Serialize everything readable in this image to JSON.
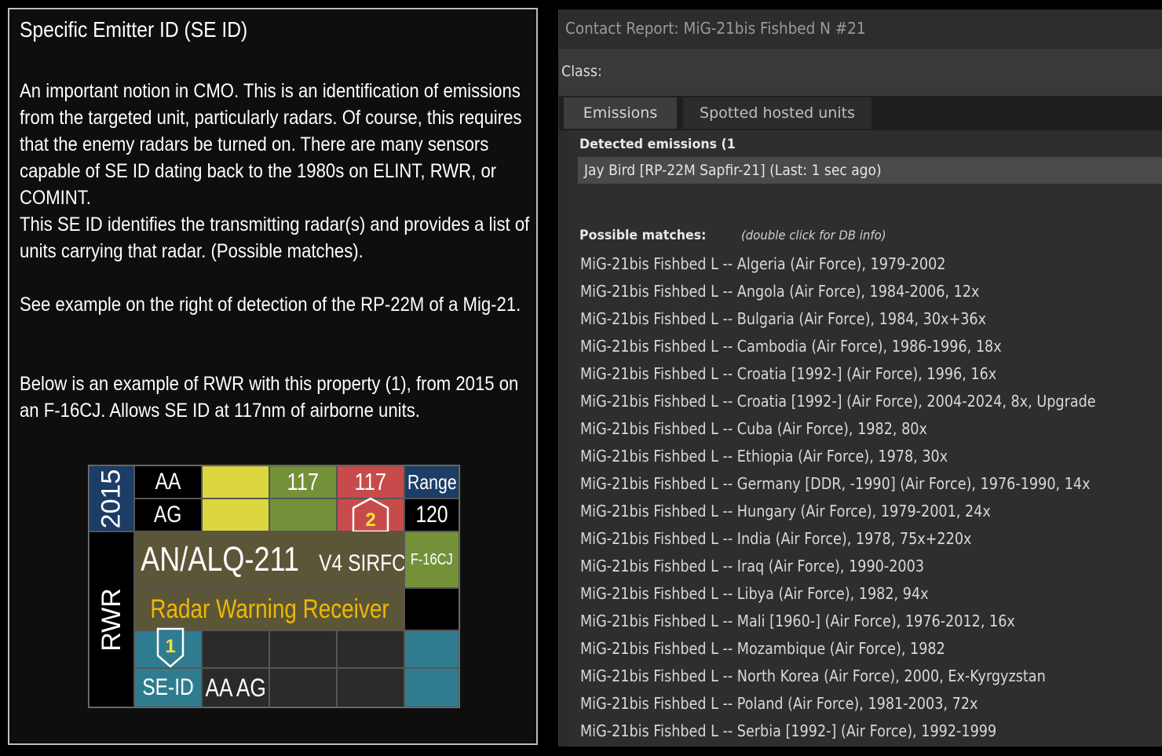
{
  "left": {
    "title": "Specific Emitter ID (SE ID)",
    "paragraphs": [
      "An important notion in CMO. This is an identification of emissions from the targeted unit, particularly radars. Of course, this requires that the enemy radars be turned on. There are many sensors capable of SE ID dating back to the 1980s on ELINT, RWR, or COMINT.",
      "This SE ID identifies the transmitting radar(s) and provides a list of units carrying that radar. (Possible matches).",
      "See example on the right of detection of the RP-22M of a Mig-21.",
      "Below is an example of RWR with this property (1), from 2015 on an F-16CJ. Allows SE ID at 117nm of airborne units."
    ]
  },
  "card": {
    "year": "2015",
    "row_aa": "AA",
    "row_ag": "AG",
    "aa_value_green": "117",
    "aa_value_red": "117",
    "range_label": "Range",
    "range_value": "120",
    "badge2": "2",
    "sensor_name": "AN/ALQ-211",
    "sensor_variant": "V4 SIRFC",
    "platform": "F-16CJ",
    "category": "RWR",
    "sensor_type": "Radar Warning Receiver",
    "badge1": "1",
    "capability": "SE-ID",
    "targets": "AA AG",
    "colors": {
      "navy": "#1b3d66",
      "yellow": "#dcd63f",
      "green": "#74913a",
      "red": "#c74b4b",
      "olive": "#5b5638",
      "teal": "#2f7c90",
      "orange_text": "#f0b800"
    }
  },
  "report": {
    "title": "Contact Report: MiG-21bis Fishbed N #21",
    "class_label": "Class:",
    "tabs": [
      "Emissions",
      "Spotted hosted units"
    ],
    "detected_label": "Detected emissions (1",
    "emission": "Jay Bird [RP-22M Sapfir-21] (Last: 1 sec ago)",
    "matches_label": "Possible matches:",
    "matches_hint": "(double click for DB info)",
    "matches": [
      "MiG-21bis Fishbed L -- Algeria (Air Force), 1979-2002",
      "MiG-21bis Fishbed L -- Angola (Air Force), 1984-2006, 12x",
      "MiG-21bis Fishbed L -- Bulgaria (Air Force), 1984, 30x+36x",
      "MiG-21bis Fishbed L -- Cambodia (Air Force), 1986-1996, 18x",
      "MiG-21bis Fishbed L -- Croatia [1992-] (Air Force), 1996, 16x",
      "MiG-21bis Fishbed L -- Croatia [1992-] (Air Force), 2004-2024, 8x, Upgrade",
      "MiG-21bis Fishbed L -- Cuba (Air Force), 1982, 80x",
      "MiG-21bis Fishbed L -- Ethiopia (Air Force), 1978, 30x",
      "MiG-21bis Fishbed L -- Germany [DDR, -1990] (Air Force), 1976-1990, 14x",
      "MiG-21bis Fishbed L -- Hungary (Air Force), 1979-2001, 24x",
      "MiG-21bis Fishbed L -- India (Air Force), 1978, 75x+220x",
      "MiG-21bis Fishbed L -- Iraq (Air Force), 1990-2003",
      "MiG-21bis Fishbed L -- Libya (Air Force), 1982, 94x",
      "MiG-21bis Fishbed L -- Mali [1960-] (Air Force), 1976-2012, 16x",
      "MiG-21bis Fishbed L -- Mozambique (Air Force), 1982",
      "MiG-21bis Fishbed L -- North Korea (Air Force), 2000, Ex-Kyrgyzstan",
      "MiG-21bis Fishbed L -- Poland (Air Force), 1981-2003, 72x",
      "MiG-21bis Fishbed L -- Serbia [1992-] (Air Force), 1992-1999"
    ]
  }
}
